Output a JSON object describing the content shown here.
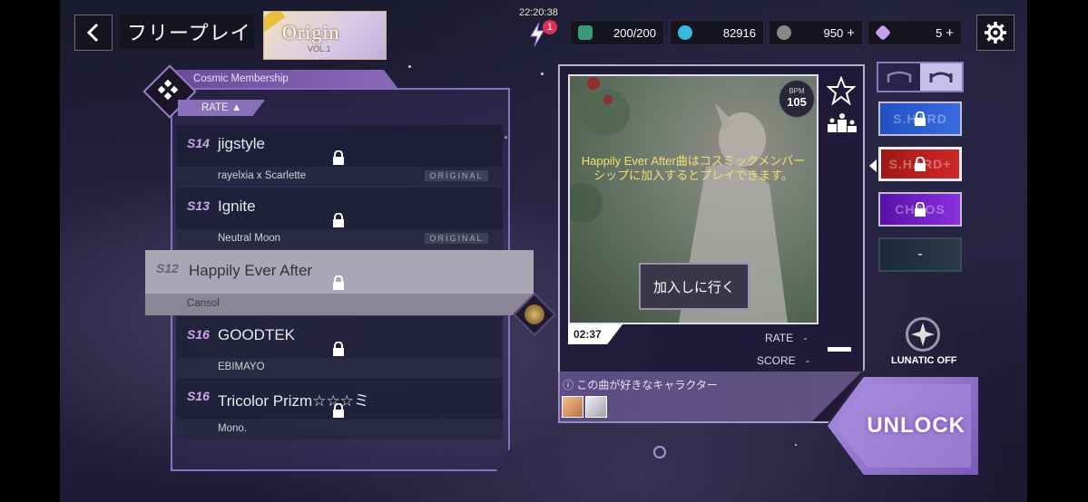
{
  "header": {
    "title": "フリープレイ",
    "album_title": "Origin",
    "album_volume": "VOL.1",
    "clock": "22:20:38",
    "energy_badge": "1",
    "resources": {
      "stamina": "200/200",
      "currency": "82916",
      "disc": "950",
      "gem": "5"
    },
    "plus": "+"
  },
  "song_list": {
    "membership_label": "Cosmic Membership",
    "sort_label": "RATE ▲",
    "songs": [
      {
        "level": "S14",
        "title": "jigstyle",
        "artist": "rayelxia x Scarlette",
        "tag": "ORIGINAL"
      },
      {
        "level": "S13",
        "title": "Ignite",
        "artist": "Neutral Moon",
        "tag": "ORIGINAL"
      },
      {
        "level": "S12",
        "title": "Happily Ever After",
        "artist": "Cansol",
        "tag": ""
      },
      {
        "level": "S16",
        "title": "GOODTEK",
        "artist": "EBIMAYO",
        "tag": ""
      },
      {
        "level": "S16",
        "title": "Tricolor Prizm☆☆☆ミ",
        "artist": "Mono.",
        "tag": ""
      }
    ]
  },
  "detail": {
    "locked_message": "Happily Ever After曲はコスミックメンバーシップに加入するとプレイできます。",
    "join_button": "加入しに行く",
    "bpm_label": "BPM",
    "bpm_value": "105",
    "duration": "02:37",
    "rate_label": "RATE",
    "rate_value": "-",
    "score_label": "SCORE",
    "score_value": "-",
    "character_label": "ⓘ この曲が好きなキャラクター"
  },
  "difficulties": [
    {
      "label": "S.HARD",
      "color": "#2a5ad0"
    },
    {
      "label": "S.HARD+",
      "color": "#c02020"
    },
    {
      "label": "CHAOS",
      "color": "#7a20c8"
    },
    {
      "label": "-",
      "color": "#2a3a4a"
    }
  ],
  "lunatic_label": "LUNATIC OFF",
  "unlock_label": "UNLOCK",
  "colors": {
    "accent": "#8a70c0",
    "selected_row": "#aaa6b6",
    "warning_text": "#f0e070"
  }
}
